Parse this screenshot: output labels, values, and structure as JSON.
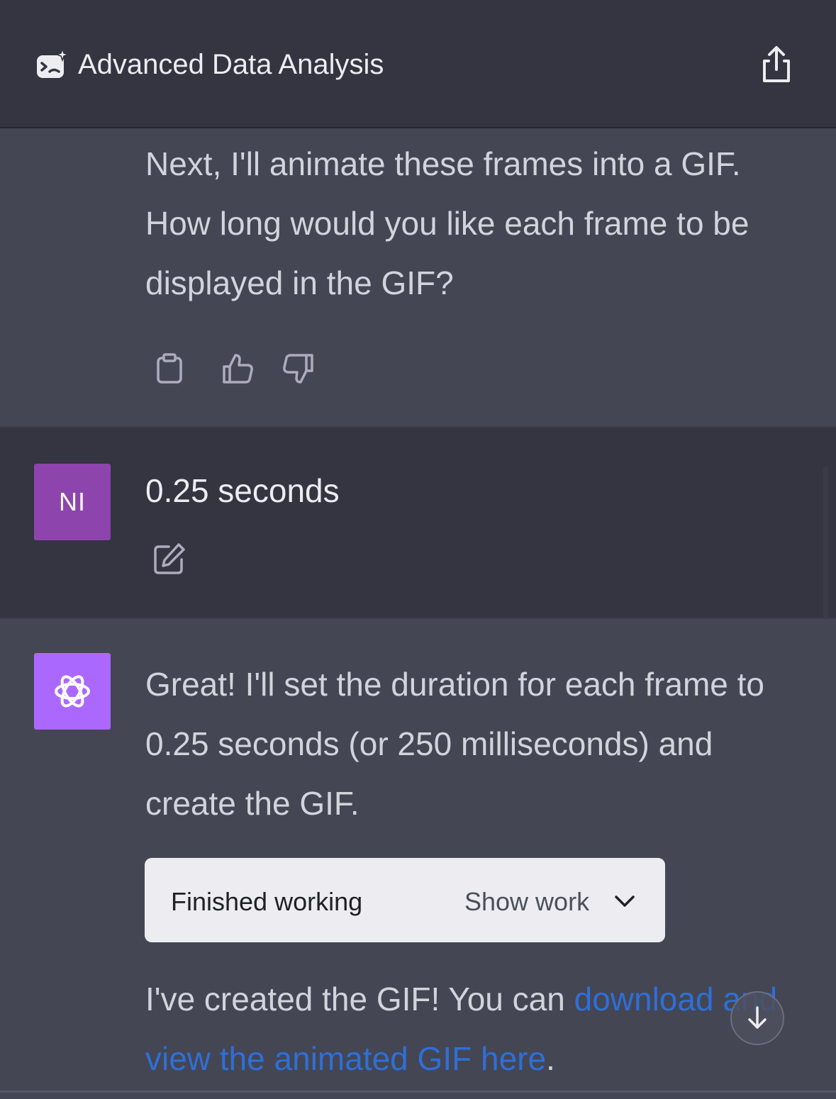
{
  "header": {
    "title": "Advanced Data Analysis",
    "icon": "data-analysis-icon",
    "share_icon": "share-icon"
  },
  "messages": [
    {
      "role": "assistant",
      "text": "Next, I'll animate these frames into a GIF. How long would you like each frame to be displayed in the GIF?",
      "actions": [
        "copy-icon",
        "thumbs-up-icon",
        "thumbs-down-icon"
      ]
    },
    {
      "role": "user",
      "avatar_initials": "NI",
      "text": "0.25 seconds",
      "actions": [
        "edit-icon"
      ]
    },
    {
      "role": "assistant",
      "avatar_icon": "openai-logo-icon",
      "text": "Great! I'll set the duration for each frame to 0.25 seconds (or 250 milliseconds) and create the GIF.",
      "work_status": "Finished working",
      "show_work_label": "Show work",
      "followup_prefix": "I've created the GIF! You can ",
      "followup_link": "download and view the animated GIF here",
      "followup_suffix": "."
    }
  ],
  "colors": {
    "background": "#343541",
    "assistant_background": "#444654",
    "user_avatar": "#8e44ad",
    "assistant_avatar": "#ab68ff",
    "link": "#2f6fd6"
  }
}
